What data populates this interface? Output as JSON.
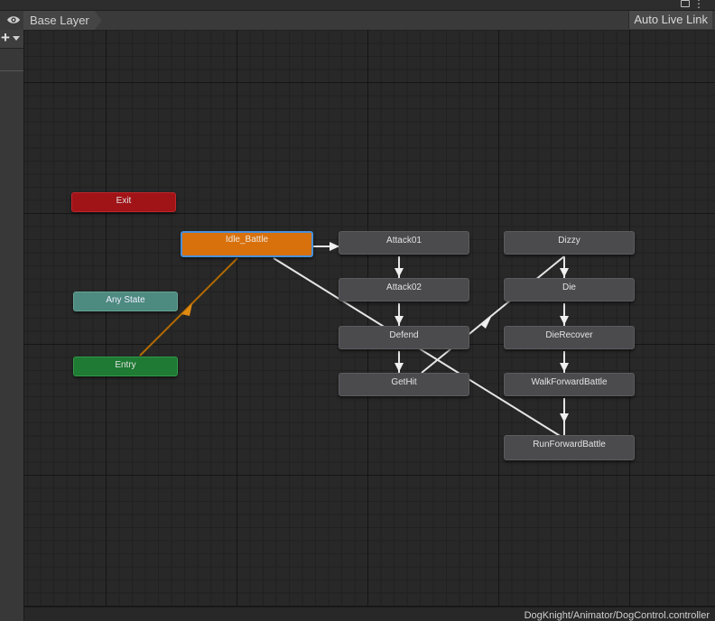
{
  "toolbar": {
    "layer_name": "Base Layer",
    "auto_live_link": "Auto Live Link"
  },
  "icons": {
    "visibility": "eye-icon",
    "add": "plus-icon",
    "dropdown": "caret-down-icon",
    "lock": "lock-icon",
    "menu": "kebab-icon"
  },
  "colors": {
    "default_state": "#d8700c",
    "selected_outline": "#4a90d8",
    "exit": "#a01418",
    "any_state": "#4d8a7f",
    "entry": "#1f7a34",
    "state": "#4b4b4e",
    "entry_transition": "#b36b00",
    "transition": "#e6e6e6"
  },
  "special_states": {
    "exit": "Exit",
    "any_state": "Any State",
    "entry": "Entry"
  },
  "states": {
    "idle_battle": "Idle_Battle",
    "attack01": "Attack01",
    "attack02": "Attack02",
    "defend": "Defend",
    "gethit": "GetHit",
    "dizzy": "Dizzy",
    "die": "Die",
    "dierecover": "DieRecover",
    "walkforwardbattle": "WalkForwardBattle",
    "runforwardbattle": "RunForwardBattle"
  },
  "transitions": [
    {
      "from": "Entry",
      "to": "Idle_Battle"
    },
    {
      "from": "Idle_Battle",
      "to": "Attack01"
    },
    {
      "from": "Idle_Battle",
      "to": "RunForwardBattle"
    },
    {
      "from": "Attack01",
      "to": "Attack02"
    },
    {
      "from": "Attack02",
      "to": "Defend"
    },
    {
      "from": "Defend",
      "to": "GetHit"
    },
    {
      "from": "GetHit",
      "to": "Dizzy"
    },
    {
      "from": "Dizzy",
      "to": "Die"
    },
    {
      "from": "Die",
      "to": "DieRecover"
    },
    {
      "from": "DieRecover",
      "to": "WalkForwardBattle"
    },
    {
      "from": "WalkForwardBattle",
      "to": "RunForwardBattle"
    }
  ],
  "status": {
    "path": "DogKnight/Animator/DogControl.controller"
  }
}
